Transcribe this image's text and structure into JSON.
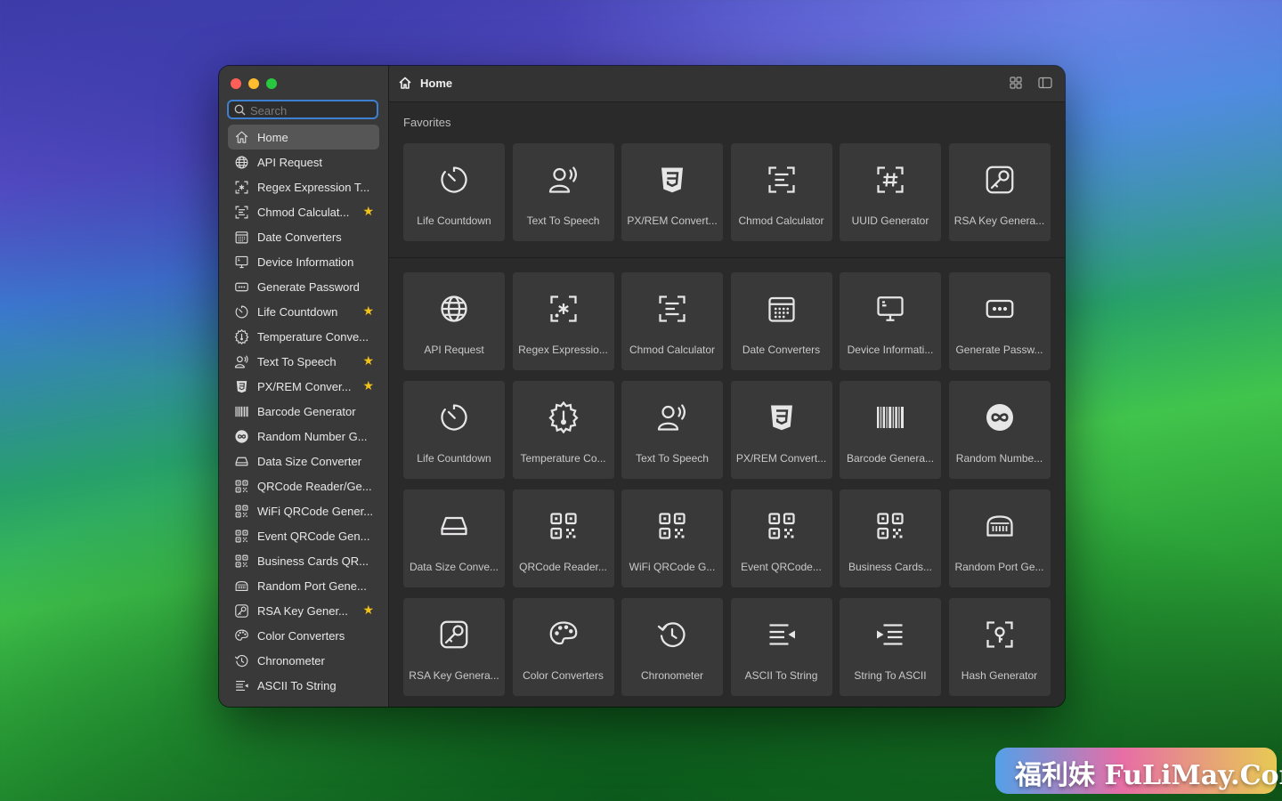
{
  "window": {
    "title": "Home",
    "search_placeholder": "Search"
  },
  "sidebar": {
    "items": [
      {
        "label": "Home",
        "icon": "house-icon",
        "active": true,
        "starred": false
      },
      {
        "label": "API Request",
        "icon": "globe-icon",
        "starred": false
      },
      {
        "label": "Regex Expression T...",
        "icon": "regex-icon",
        "starred": false
      },
      {
        "label": "Chmod Calculat...",
        "icon": "chmod-icon",
        "starred": true
      },
      {
        "label": "Date Converters",
        "icon": "calendar-icon",
        "starred": false
      },
      {
        "label": "Device Information",
        "icon": "monitor-icon",
        "starred": false
      },
      {
        "label": "Generate Password",
        "icon": "password-icon",
        "starred": false
      },
      {
        "label": "Life Countdown",
        "icon": "timer-icon",
        "starred": true
      },
      {
        "label": "Temperature Conve...",
        "icon": "thermometer-icon",
        "starred": false
      },
      {
        "label": "Text To Speech",
        "icon": "speaker-person-icon",
        "starred": true
      },
      {
        "label": "PX/REM Conver...",
        "icon": "css3-icon",
        "starred": true
      },
      {
        "label": "Barcode Generator",
        "icon": "barcode-icon",
        "starred": false
      },
      {
        "label": "Random Number G...",
        "icon": "infinity-icon",
        "starred": false
      },
      {
        "label": "Data Size Converter",
        "icon": "drive-icon",
        "starred": false
      },
      {
        "label": "QRCode Reader/Ge...",
        "icon": "qrcode-icon",
        "starred": false
      },
      {
        "label": "WiFi QRCode Gener...",
        "icon": "qrcode-icon",
        "starred": false
      },
      {
        "label": "Event QRCode Gen...",
        "icon": "qrcode-icon",
        "starred": false
      },
      {
        "label": "Business Cards QR...",
        "icon": "qrcode-icon",
        "starred": false
      },
      {
        "label": "Random Port Gene...",
        "icon": "port-icon",
        "starred": false
      },
      {
        "label": "RSA Key Gener...",
        "icon": "key-icon",
        "starred": true
      },
      {
        "label": "Color Converters",
        "icon": "palette-icon",
        "starred": false
      },
      {
        "label": "Chronometer",
        "icon": "history-icon",
        "starred": false
      },
      {
        "label": "ASCII To String",
        "icon": "lines-left-arrow-icon",
        "starred": false
      }
    ]
  },
  "main": {
    "favorites_heading": "Favorites",
    "favorites": [
      {
        "label": "Life Countdown",
        "icon": "timer-icon"
      },
      {
        "label": "Text To Speech",
        "icon": "speaker-person-icon"
      },
      {
        "label": "PX/REM Convert...",
        "icon": "css3-icon"
      },
      {
        "label": "Chmod Calculator",
        "icon": "chmod-icon"
      },
      {
        "label": "UUID Generator",
        "icon": "uuid-icon"
      },
      {
        "label": "RSA Key Genera...",
        "icon": "key-icon"
      }
    ],
    "tools": [
      {
        "label": "API Request",
        "icon": "globe-icon"
      },
      {
        "label": "Regex Expressio...",
        "icon": "regex-icon"
      },
      {
        "label": "Chmod Calculator",
        "icon": "chmod-icon"
      },
      {
        "label": "Date Converters",
        "icon": "calendar-icon"
      },
      {
        "label": "Device Informati...",
        "icon": "monitor-icon"
      },
      {
        "label": "Generate Passw...",
        "icon": "password-icon"
      },
      {
        "label": "Life Countdown",
        "icon": "timer-icon"
      },
      {
        "label": "Temperature Co...",
        "icon": "thermometer-icon"
      },
      {
        "label": "Text To Speech",
        "icon": "speaker-person-icon"
      },
      {
        "label": "PX/REM Convert...",
        "icon": "css3-icon"
      },
      {
        "label": "Barcode Genera...",
        "icon": "barcode-icon"
      },
      {
        "label": "Random Numbe...",
        "icon": "infinity-icon"
      },
      {
        "label": "Data Size Conve...",
        "icon": "drive-icon"
      },
      {
        "label": "QRCode Reader...",
        "icon": "qrcode-icon"
      },
      {
        "label": "WiFi QRCode G...",
        "icon": "qrcode-icon"
      },
      {
        "label": "Event QRCode...",
        "icon": "qrcode-icon"
      },
      {
        "label": "Business Cards...",
        "icon": "qrcode-icon"
      },
      {
        "label": "Random Port Ge...",
        "icon": "port-icon"
      },
      {
        "label": "RSA Key Genera...",
        "icon": "key-icon"
      },
      {
        "label": "Color Converters",
        "icon": "palette-icon"
      },
      {
        "label": "Chronometer",
        "icon": "history-icon"
      },
      {
        "label": "ASCII To String",
        "icon": "lines-left-arrow-icon"
      },
      {
        "label": "String To ASCII",
        "icon": "arrow-lines-right-icon"
      },
      {
        "label": "Hash Generator",
        "icon": "hash-key-icon"
      }
    ]
  },
  "watermark": {
    "text": "福利妹 FuLiMay.Com"
  },
  "colors": {
    "accent": "#3d7fd1",
    "star": "#f2c21b",
    "sidebar_bg": "#3a3939",
    "card_bg": "#3a393a",
    "main_bg": "#2b2a2b"
  }
}
